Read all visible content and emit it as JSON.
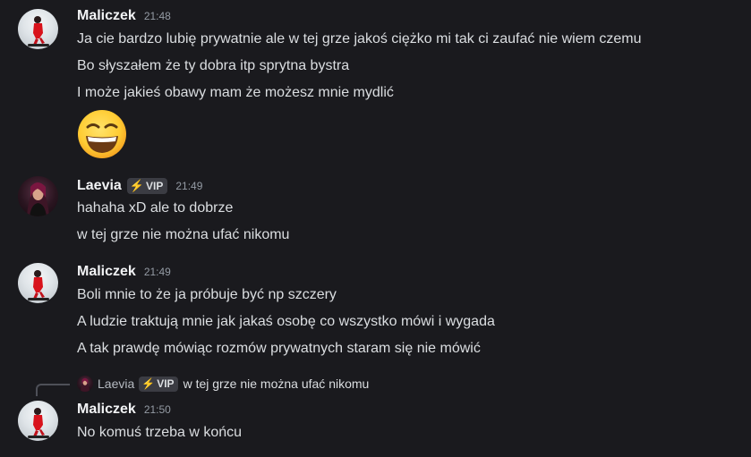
{
  "messages": [
    {
      "author": "Maliczek",
      "time": "21:48",
      "lines": [
        "Ja cie bardzo lubię prywatnie ale w tej grze jakoś ciężko mi tak ci zaufać nie wiem czemu",
        "Bo słyszałem że ty dobra itp sprytna bystra",
        "I może jakieś obawy mam że możesz mnie mydlić"
      ],
      "emoji": "grinning-squinting-face"
    },
    {
      "author": "Laevia",
      "badge": "VIP",
      "time": "21:49",
      "lines": [
        "hahaha xD ale to dobrze",
        "w tej grze nie można ufać nikomu"
      ]
    },
    {
      "author": "Maliczek",
      "time": "21:49",
      "lines": [
        "Boli mnie to że ja próbuje być np szczery",
        "A ludzie traktują mnie jak jakaś osobę co wszystko mówi i wygada",
        "A tak prawdę mówiąc rozmów prywatnych staram się nie mówić"
      ]
    },
    {
      "reply": {
        "author": "Laevia",
        "badge": "VIP",
        "text": "w tej grze nie można ufać nikomu"
      },
      "author": "Maliczek",
      "time": "21:50",
      "lines": [
        "No komuś trzeba w końcu"
      ]
    }
  ],
  "colors": {
    "background": "#1a1a1e",
    "username": "#f2f3f5",
    "text": "#dbdee1",
    "timestamp": "#949ba4",
    "badge_bg": "#3b3c43",
    "bolt": "#f0b232"
  }
}
